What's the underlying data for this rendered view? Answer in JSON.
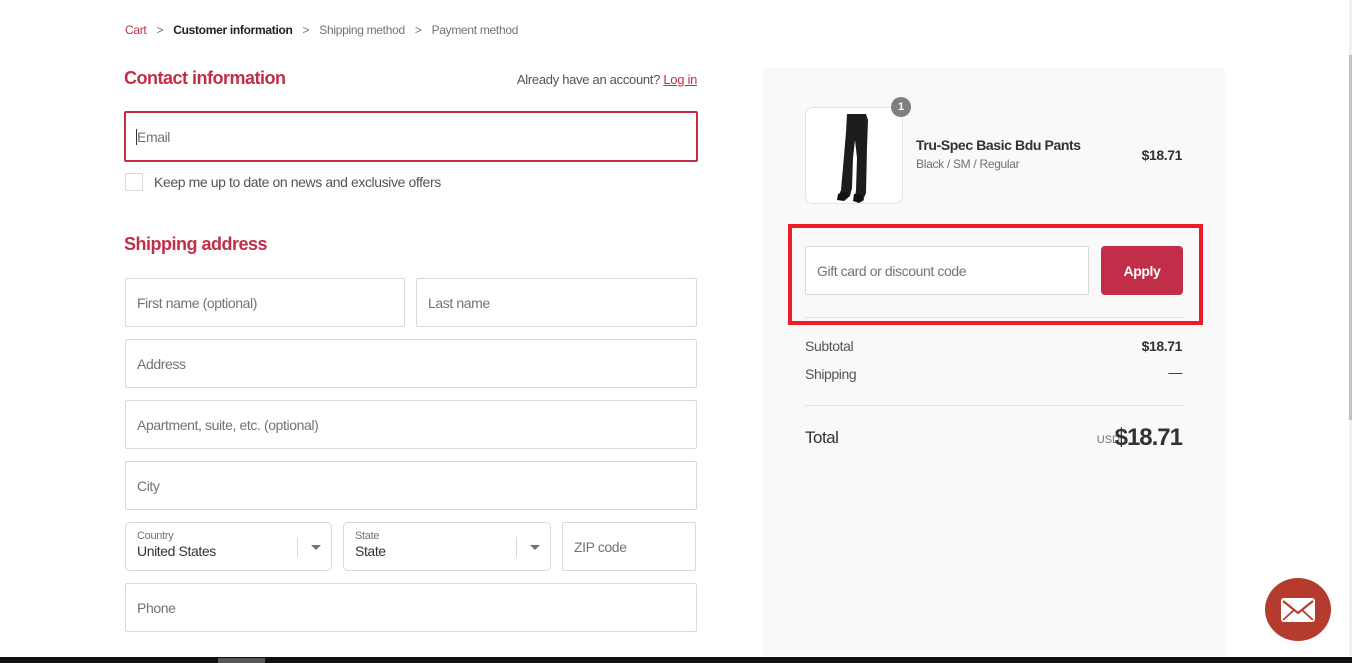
{
  "breadcrumb": [
    {
      "label": "Cart",
      "state": "link"
    },
    {
      "label": "Customer information",
      "state": "current"
    },
    {
      "label": "Shipping method",
      "state": "upcoming"
    },
    {
      "label": "Payment method",
      "state": "upcoming"
    }
  ],
  "breadcrumb_separator": ">",
  "contact": {
    "title": "Contact information",
    "account_prompt": "Already have an account?",
    "login_label": "Log in",
    "email_placeholder": "Email",
    "email_value": "",
    "newsletter_label": "Keep me up to date on news and exclusive offers",
    "newsletter_checked": false
  },
  "shipping": {
    "title": "Shipping address",
    "first_name_placeholder": "First name (optional)",
    "last_name_placeholder": "Last name",
    "address_placeholder": "Address",
    "apartment_placeholder": "Apartment, suite, etc. (optional)",
    "city_placeholder": "City",
    "country": {
      "label": "Country",
      "value": "United States"
    },
    "state": {
      "label": "State",
      "value": "State"
    },
    "zip_placeholder": "ZIP code",
    "phone_placeholder": "Phone"
  },
  "order_summary": {
    "items": [
      {
        "name": "Tru-Spec Basic Bdu Pants",
        "variant": "Black / SM / Regular",
        "price": "$18.71",
        "quantity": "1",
        "image": "black-pants-product-image"
      }
    ],
    "discount_placeholder": "Gift card or discount code",
    "apply_label": "Apply",
    "subtotal_label": "Subtotal",
    "subtotal_value": "$18.71",
    "shipping_label": "Shipping",
    "shipping_value": "—",
    "total_label": "Total",
    "total_currency": "USD",
    "total_value": "$18.71"
  },
  "chat_widget": {
    "icon": "envelope-icon"
  },
  "colors": {
    "brand": "#c12e48",
    "highlight": "#ee1c25",
    "chat": "#b53b2f",
    "sidebar_bg": "#f9f9f9"
  }
}
